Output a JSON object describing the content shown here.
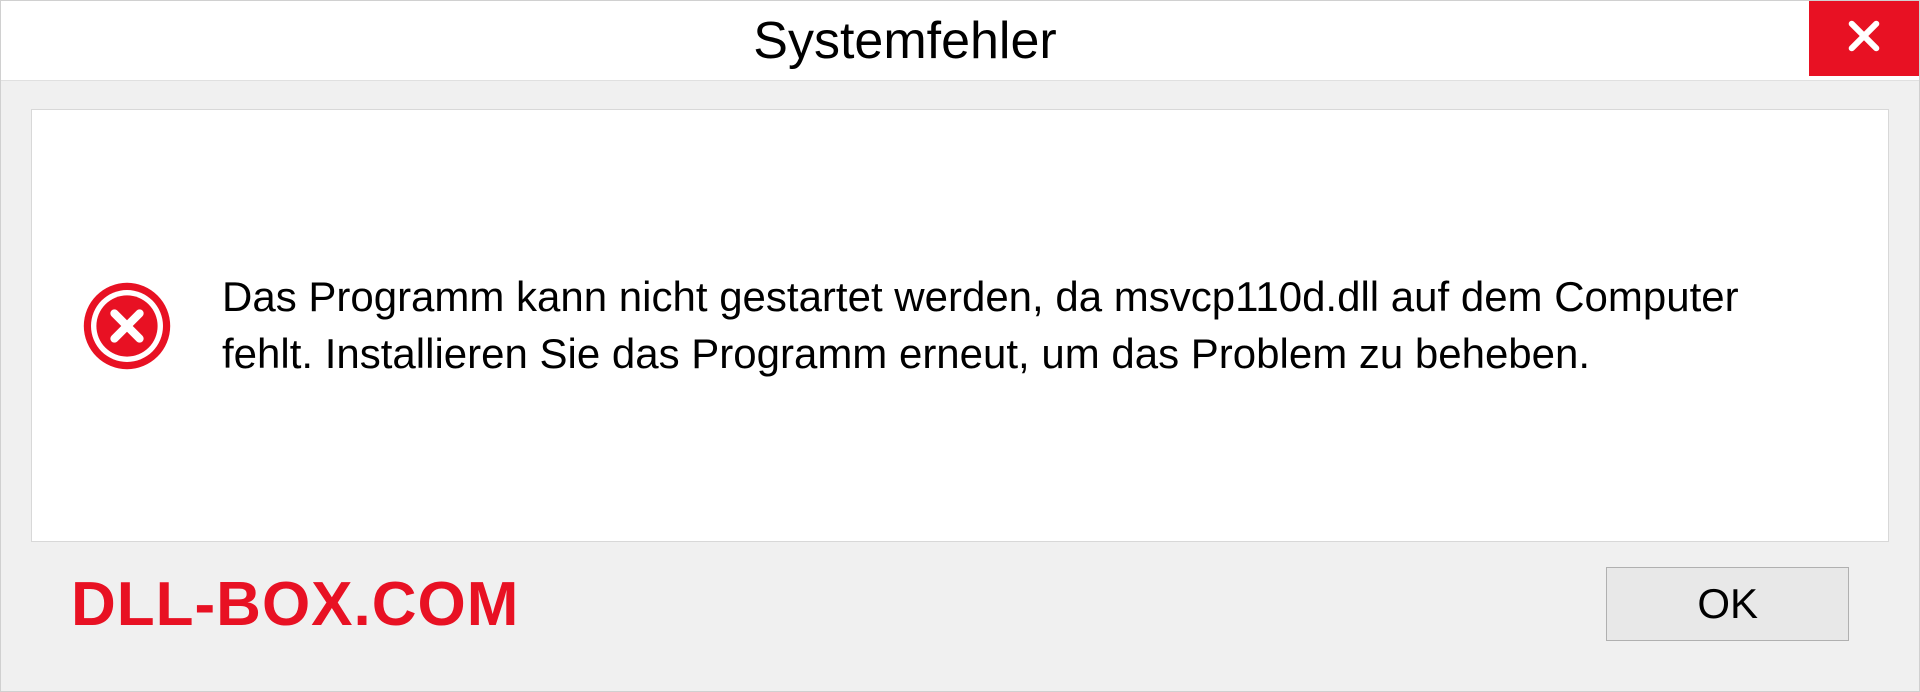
{
  "dialog": {
    "title": "Systemfehler",
    "message": "Das Programm kann nicht gestartet werden, da msvcp110d.dll auf dem Computer fehlt. Installieren Sie das Programm erneut, um das Problem zu beheben.",
    "ok_label": "OK"
  },
  "watermark": "DLL-BOX.COM"
}
